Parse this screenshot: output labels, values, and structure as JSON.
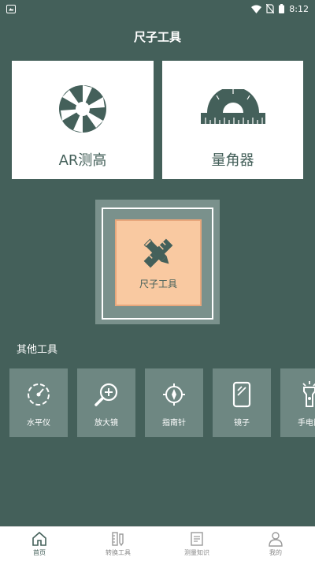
{
  "status_bar": {
    "time": "8:12",
    "icons": [
      "image-icon",
      "wifi-icon",
      "no-sim-icon",
      "battery-icon"
    ]
  },
  "header": {
    "title": "尺子工具"
  },
  "cards": {
    "ar": {
      "label": "AR测高",
      "icon": "aperture-icon"
    },
    "angle": {
      "label": "量角器",
      "icon": "protractor-icon"
    },
    "ruler": {
      "label": "尺子工具",
      "icon": "pencil-ruler-icon"
    }
  },
  "other_tools": {
    "title": "其他工具",
    "items": [
      {
        "label": "水平仪",
        "icon": "level-gauge-icon"
      },
      {
        "label": "放大镜",
        "icon": "magnifier-icon"
      },
      {
        "label": "指南针",
        "icon": "compass-icon"
      },
      {
        "label": "镜子",
        "icon": "mirror-icon"
      },
      {
        "label": "手电筒",
        "icon": "flashlight-icon"
      }
    ]
  },
  "tab_bar": {
    "items": [
      {
        "label": "首页",
        "icon": "home-icon",
        "active": true
      },
      {
        "label": "转换工具",
        "icon": "convert-tool-icon",
        "active": false
      },
      {
        "label": "测量知识",
        "icon": "document-icon",
        "active": false
      },
      {
        "label": "我的",
        "icon": "user-icon",
        "active": false
      }
    ]
  },
  "colors": {
    "background": "#44605a",
    "card": "#ffffff",
    "accent": "#f9c9a1",
    "tool_tile": "#6e8782"
  }
}
